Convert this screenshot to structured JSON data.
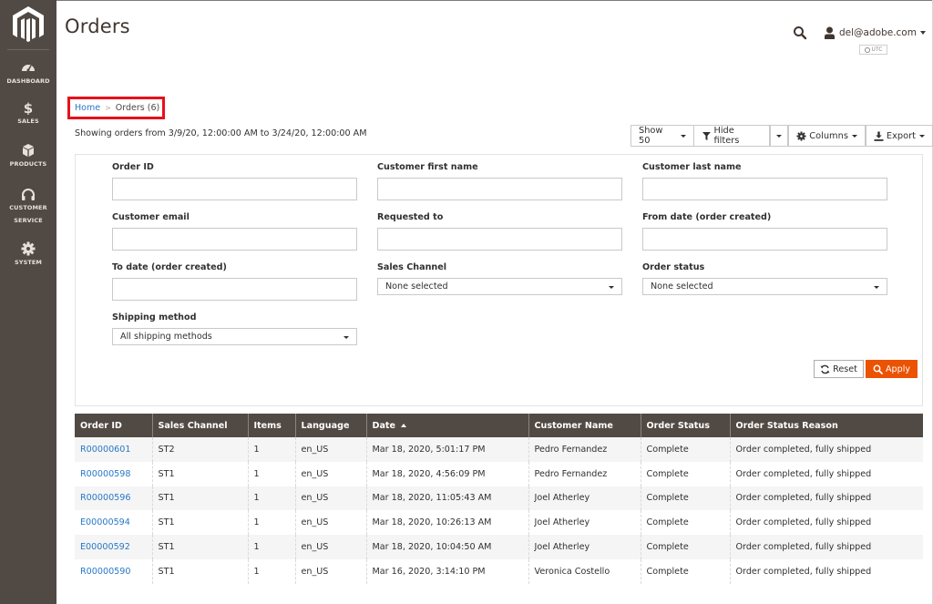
{
  "sidebar": {
    "logo": "magento-logo",
    "items": [
      {
        "label": "DASHBOARD",
        "icon": "dashboard-gauge-icon"
      },
      {
        "label": "SALES",
        "icon": "dollar-icon"
      },
      {
        "label": "PRODUCTS",
        "icon": "box-icon"
      },
      {
        "label": "CUSTOMER",
        "label2": "SERVICE",
        "icon": "headphones-icon"
      },
      {
        "label": "SYSTEM",
        "icon": "gear-icon"
      }
    ]
  },
  "header": {
    "title": "Orders",
    "user": "del@adobe.com",
    "timezone": "UTC"
  },
  "breadcrumb": {
    "home": "Home",
    "separator": ">",
    "current": "Orders (6)"
  },
  "showing_text": "Showing orders from 3/9/20, 12:00:00 AM to 3/24/20, 12:00:00 AM",
  "toolbar": {
    "show": "Show 50",
    "hide_filters": "Hide filters",
    "columns": "Columns",
    "export": "Export"
  },
  "filters": {
    "order_id": {
      "label": "Order ID",
      "value": ""
    },
    "first_name": {
      "label": "Customer first name",
      "value": ""
    },
    "last_name": {
      "label": "Customer last name",
      "value": ""
    },
    "email": {
      "label": "Customer email",
      "value": ""
    },
    "requested_to": {
      "label": "Requested to",
      "value": ""
    },
    "from_date": {
      "label": "From date (order created)",
      "value": ""
    },
    "to_date": {
      "label": "To date (order created)",
      "value": ""
    },
    "sales_channel": {
      "label": "Sales Channel",
      "value": "None selected"
    },
    "order_status": {
      "label": "Order status",
      "value": "None selected"
    },
    "shipping_method": {
      "label": "Shipping method",
      "value": "All shipping methods"
    },
    "reset": "Reset",
    "apply": "Apply"
  },
  "colors": {
    "sidebar": "#514943",
    "accent": "#eb5202",
    "link": "#2878c7",
    "highlight_box": "#e8101b"
  },
  "table": {
    "columns": [
      "Order ID",
      "Sales Channel",
      "Items",
      "Language",
      "Date",
      "Customer Name",
      "Order Status",
      "Order Status Reason"
    ],
    "sorted_column": "Date",
    "rows": [
      [
        "R00000601",
        "ST2",
        "1",
        "en_US",
        "Mar 18, 2020, 5:01:17 PM",
        "Pedro Fernandez",
        "Complete",
        "Order completed, fully shipped"
      ],
      [
        "R00000598",
        "ST1",
        "1",
        "en_US",
        "Mar 18, 2020, 4:56:09 PM",
        "Pedro Fernandez",
        "Complete",
        "Order completed, fully shipped"
      ],
      [
        "R00000596",
        "ST1",
        "1",
        "en_US",
        "Mar 18, 2020, 11:05:43 AM",
        "Joel Atherley",
        "Complete",
        "Order completed, fully shipped"
      ],
      [
        "E00000594",
        "ST1",
        "1",
        "en_US",
        "Mar 18, 2020, 10:26:13 AM",
        "Joel Atherley",
        "Complete",
        "Order completed, fully shipped"
      ],
      [
        "E00000592",
        "ST1",
        "1",
        "en_US",
        "Mar 18, 2020, 10:04:50 AM",
        "Joel Atherley",
        "Complete",
        "Order completed, fully shipped"
      ],
      [
        "R00000590",
        "ST1",
        "1",
        "en_US",
        "Mar 16, 2020, 3:14:10 PM",
        "Veronica Costello",
        "Complete",
        "Order completed, fully shipped"
      ]
    ]
  }
}
